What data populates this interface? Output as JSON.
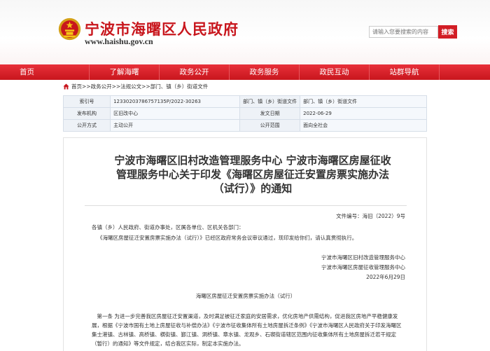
{
  "header": {
    "site_title": "宁波市海曙区人民政府",
    "site_url": "www.haishu.gov.cn",
    "search_placeholder": "请输入您要搜索的内容",
    "search_label": "搜索"
  },
  "nav": [
    "首页",
    "了解海曙",
    "政务公开",
    "政务服务",
    "政民互动",
    "站群导航"
  ],
  "breadcrumb": "首页>>政务公开>>法规公文>>部门、镇（乡）街道文件",
  "info": {
    "index_label": "索引号",
    "index_value": "12330203786757135P/2022-30263",
    "org_label": "部门、镇（乡）街道文件",
    "org_value": "部门、镇（乡）街道文件",
    "publisher_label": "发布机构",
    "publisher_value": "区旧改中心",
    "date_label": "发文日期",
    "date_value": "2022-06-29",
    "open_mode_label": "公开方式",
    "open_mode_value": "主动公开",
    "scope_label": "公开范围",
    "scope_value": "面向全社会"
  },
  "document": {
    "title": "宁波市海曙区旧村改造管理服务中心 宁波市海曙区房屋征收管理服务中心关于印发《海曙区房屋征迁安置房票实施办法（试行）》的通知",
    "doc_number": "文件编号：海旧（2022）9号",
    "addressee": "各镇（乡）人民政府、街道办事处，区属各单位、区机关各部门：",
    "intro": "《海曙区房屋征迁安置房票实施办法（试行）》已经区政府常务会议审议通过，现印发给你们，请认真贯彻执行。",
    "signer1": "宁波市海曙区旧村改造管理服务中心",
    "signer2": "宁波市海曙区房屋征收管理服务中心",
    "sign_date": "2022年6月29日",
    "sub_title": "海曙区房屋征迁安置房票实施办法（试行）",
    "article1": "第一条 为进一步完善我区房屋征迁安置渠道，及时满足被征迁家庭的安居需求，优化房地产供需结构，促进我区房地产平稳健康发展，根据《宁波市国有土地上房屋征收与补偿办法》《宁波市征收集体所有土地房屋拆迁条例》《宁波市海曙区人民政府关于印发海曙区集士港镇、古林镇、高桥镇、横街镇、鄞江镇、洞桥镇、章水镇、龙观乡、石碶街道辖区范围内征收集体所有土地房屋拆迁若干规定（暂行）的通知》等文件规定，结合我区实际，制定本实施办法。"
  },
  "colors": {
    "brand_red": "#c8161d",
    "nav_red": "#d9222b"
  }
}
